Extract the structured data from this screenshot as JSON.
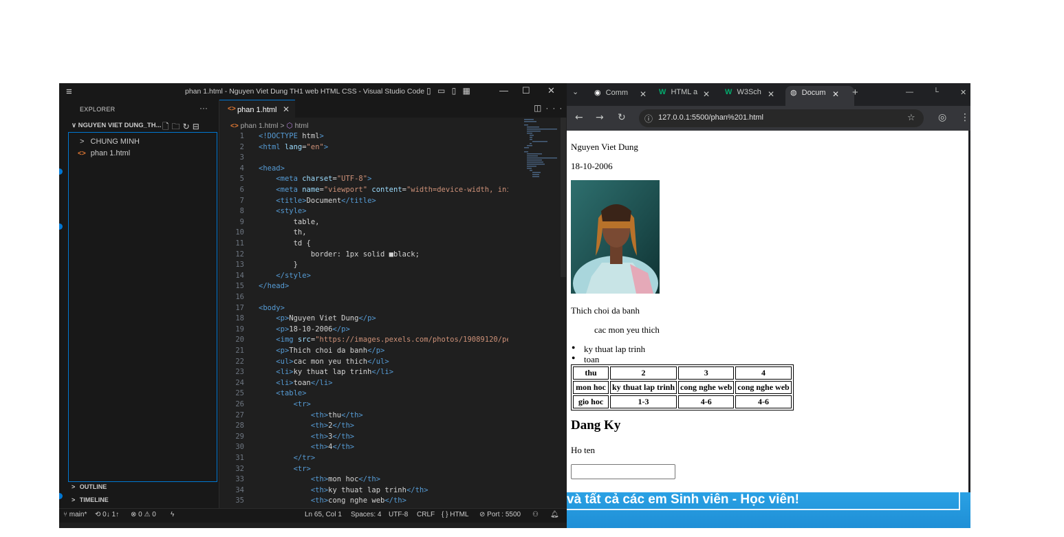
{
  "vscode": {
    "menu_icon": "≡",
    "title": "phan 1.html - Nguyen Viet Dung TH1  web HTML CSS - Visual Studio Code",
    "window_buttons": [
      "—",
      "☐",
      "✕"
    ],
    "sidebar": {
      "explorer_label": "EXPLORER",
      "more": "···",
      "folder_name": "NGUYEN VIET DUNG_TH...",
      "folder_chevron": "∨",
      "items": [
        {
          "chevron": ">",
          "label": "CHUNG MINH"
        },
        {
          "icon": "<>",
          "label": "phan 1.html"
        }
      ],
      "outline": "OUTLINE",
      "timeline": "TIMELINE"
    },
    "editor": {
      "tab_label": "phan 1.html",
      "tab_close": "✕",
      "breadcrumb_file": "phan 1.html",
      "breadcrumb_sep": ">",
      "breadcrumb_symbol": "html"
    },
    "code_lines": [
      {
        "n": "1",
        "t": "<!DOCTYPE html>"
      },
      {
        "n": "2",
        "t": "<html lang=\"en\">"
      },
      {
        "n": "3",
        "t": ""
      },
      {
        "n": "4",
        "t": "<head>"
      },
      {
        "n": "5",
        "t": "    <meta charset=\"UTF-8\">"
      },
      {
        "n": "6",
        "t": "    <meta name=\"viewport\" content=\"width=device-width, ini"
      },
      {
        "n": "7",
        "t": "    <title>Document</title>"
      },
      {
        "n": "8",
        "t": "    <style>"
      },
      {
        "n": "9",
        "t": "        table,"
      },
      {
        "n": "10",
        "t": "        th,"
      },
      {
        "n": "11",
        "t": "        td {"
      },
      {
        "n": "12",
        "t": "            border: 1px solid ■black;"
      },
      {
        "n": "13",
        "t": "        }"
      },
      {
        "n": "14",
        "t": "    </style>"
      },
      {
        "n": "15",
        "t": "</head>"
      },
      {
        "n": "16",
        "t": ""
      },
      {
        "n": "17",
        "t": "<body>"
      },
      {
        "n": "18",
        "t": "    <p>Nguyen Viet Dung</p>"
      },
      {
        "n": "19",
        "t": "    <p>18-10-2006</p>"
      },
      {
        "n": "20",
        "t": "    <img src=\"https://images.pexels.com/photos/19089120/pe"
      },
      {
        "n": "21",
        "t": "    <p>Thich choi da banh</p>"
      },
      {
        "n": "22",
        "t": "    <ul>cac mon yeu thich</ul>"
      },
      {
        "n": "23",
        "t": "    <li>ky thuat lap trinh</li>"
      },
      {
        "n": "24",
        "t": "    <li>toan</li>"
      },
      {
        "n": "25",
        "t": "    <table>"
      },
      {
        "n": "26",
        "t": "        <tr>"
      },
      {
        "n": "27",
        "t": "            <th>thu</th>"
      },
      {
        "n": "28",
        "t": "            <th>2</th>"
      },
      {
        "n": "29",
        "t": "            <th>3</th>"
      },
      {
        "n": "30",
        "t": "            <th>4</th>"
      },
      {
        "n": "31",
        "t": "        </tr>"
      },
      {
        "n": "32",
        "t": "        <tr>"
      },
      {
        "n": "33",
        "t": "            <th>mon hoc</th>"
      },
      {
        "n": "34",
        "t": "            <th>ky thuat lap trinh</th>"
      },
      {
        "n": "35",
        "t": "            <th>cong nghe web</th>"
      }
    ],
    "statusbar": {
      "branch": "main*",
      "sync": "0↓ 1↑",
      "problems": "⊗ 0 ⚠ 0",
      "position": "Ln 65, Col 1",
      "spaces": "Spaces: 4",
      "encoding": "UTF-8",
      "eol": "CRLF",
      "language": "HTML",
      "port": "Port : 5500"
    },
    "colors": {
      "tag": "#569cd6",
      "attr": "#9cdcfe",
      "string": "#ce9178",
      "text": "#d4d4d4",
      "accent": "#0078d4"
    }
  },
  "chrome": {
    "tabs": [
      {
        "label": "Comm",
        "icon": "github-icon"
      },
      {
        "label": "HTML a",
        "icon": "w3schools-icon"
      },
      {
        "label": "W3Sch",
        "icon": "w3schools-icon"
      },
      {
        "label": "Docum",
        "icon": "globe-icon"
      }
    ],
    "new_tab": "+",
    "url": "127.0.0.1:5500/phan%201.html",
    "page": {
      "name": "Nguyen Viet Dung",
      "date": "18-10-2006",
      "hobby": "Thich choi da banh",
      "favorites_title": "cac mon yeu thich",
      "list": [
        "ky thuat lap trinh",
        "toan"
      ],
      "table": [
        [
          "thu",
          "2",
          "3",
          "4"
        ],
        [
          "mon hoc",
          "ky thuat lap trinh",
          "cong nghe web",
          "cong nghe web"
        ],
        [
          "gio hoc",
          "1-3",
          "4-6",
          "4-6"
        ]
      ],
      "heading": "Dang Ky",
      "field_label": "Ho ten"
    }
  },
  "banner": {
    "text": "và tất cả các em Sinh viên - Học viên!"
  }
}
